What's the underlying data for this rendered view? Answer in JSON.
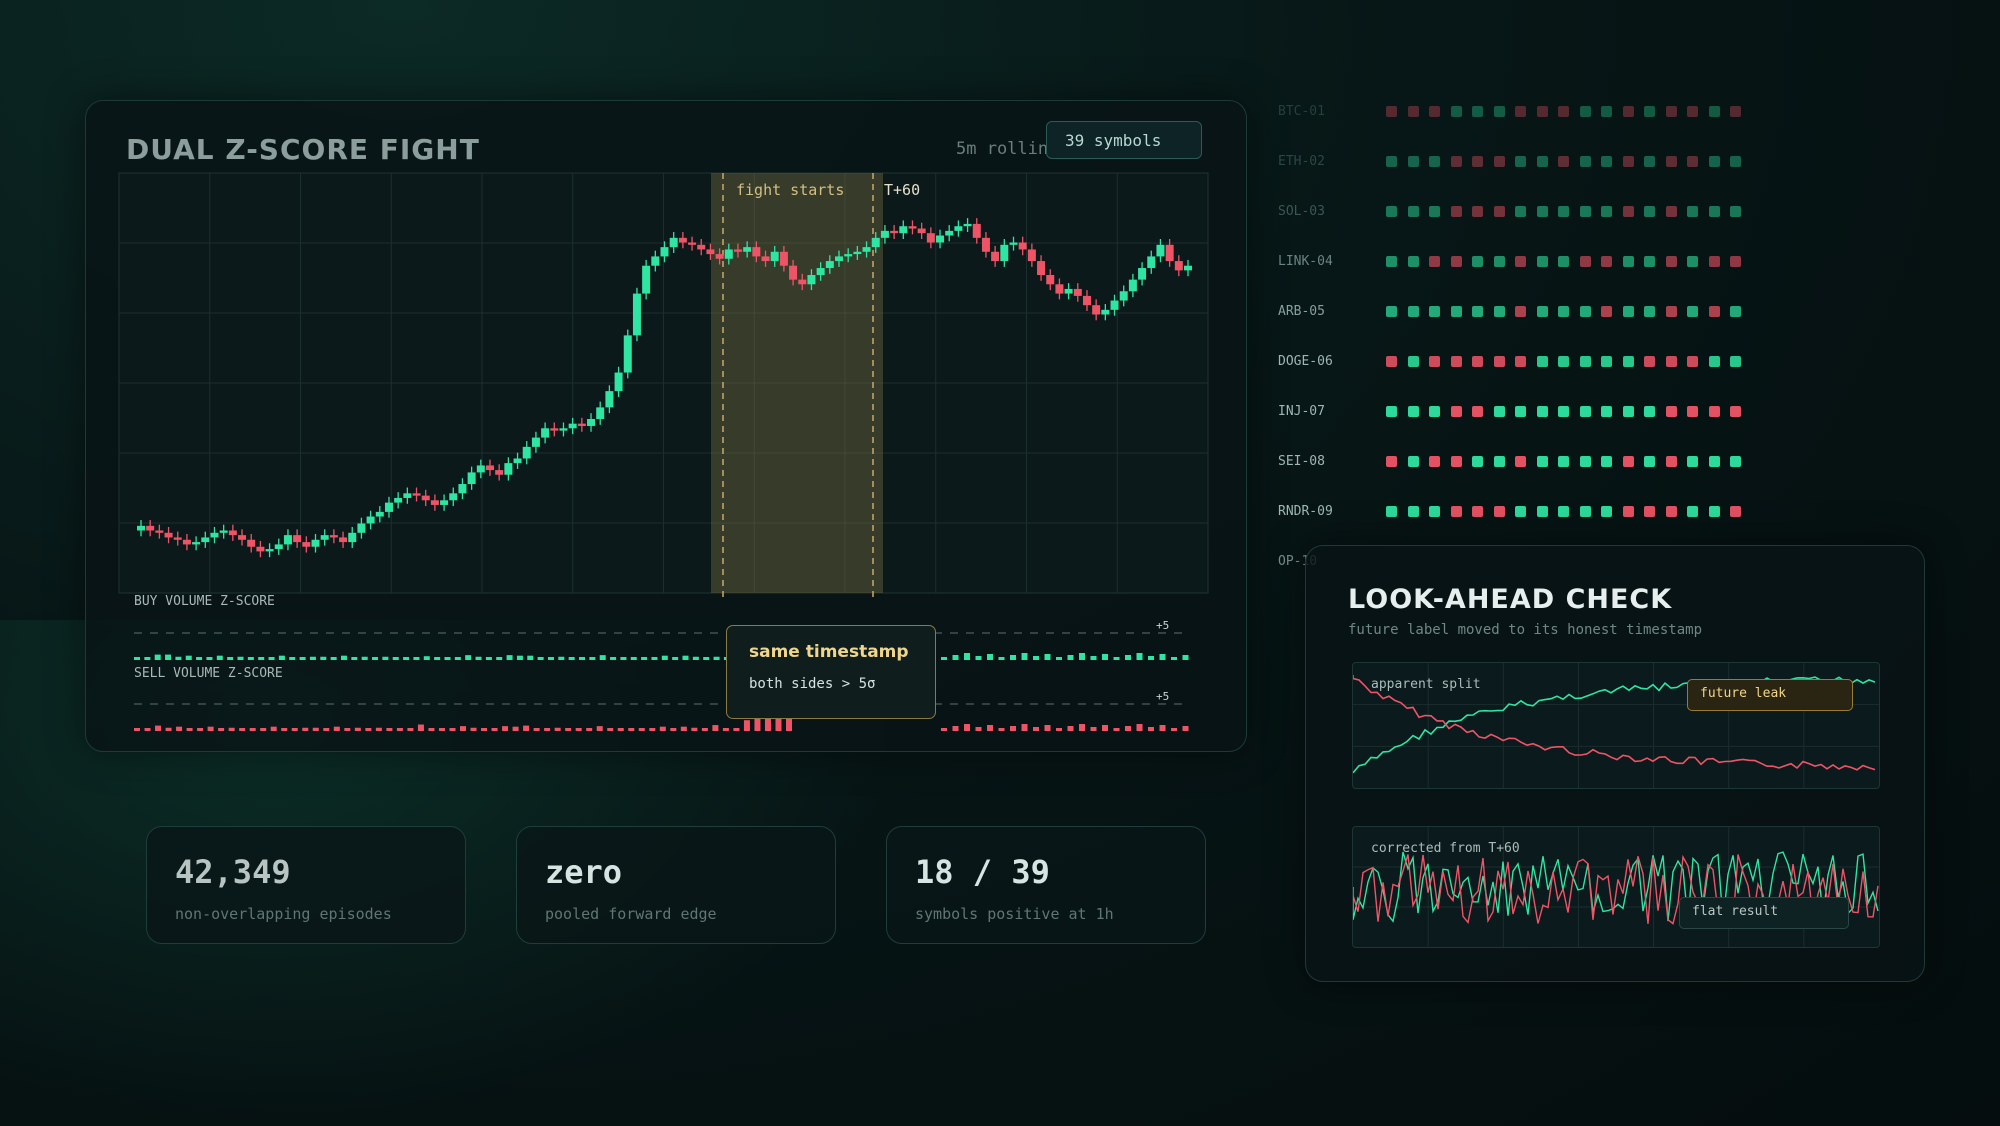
{
  "main": {
    "title": "DUAL Z-SCORE FIGHT",
    "rolling_label": "5m rollin",
    "symbols_badge": "39 symbols",
    "fight_label": "fight starts",
    "t60_label": "T+60",
    "buy_label": "BUY VOLUME Z-SCORE",
    "sell_label": "SELL VOLUME Z-SCORE",
    "buy_threshold": "+5",
    "sell_threshold": "+5",
    "callout": {
      "title": "same timestamp",
      "subtitle": "both sides > 5σ"
    },
    "colors": {
      "up": "#2ee6a2",
      "down": "#ef5466",
      "highlight": "#8a7a45"
    }
  },
  "chart_data": [
    {
      "type": "candlestick",
      "title": "DUAL Z-SCORE FIGHT",
      "highlight_window": {
        "start_index": 63,
        "end_index": 79,
        "labels": [
          "fight starts",
          "T+60"
        ]
      },
      "closes": [
        46,
        44,
        43,
        41,
        40,
        38,
        39,
        41,
        43,
        44,
        42,
        40,
        37,
        35,
        36,
        38,
        42,
        39,
        37,
        40,
        42,
        41,
        39,
        43,
        47,
        50,
        52,
        56,
        58,
        60,
        59,
        57,
        55,
        57,
        60,
        64,
        69,
        72,
        70,
        68,
        73,
        75,
        80,
        84,
        88,
        87,
        88,
        90,
        89,
        92,
        97,
        104,
        112,
        128,
        146,
        158,
        162,
        166,
        170,
        168,
        167,
        165,
        163,
        161,
        165,
        164,
        166,
        162,
        160,
        164,
        158,
        152,
        150,
        154,
        157,
        160,
        162,
        163,
        164,
        166,
        170,
        173,
        172,
        175,
        174,
        172,
        168,
        171,
        173,
        175,
        176,
        170,
        164,
        160,
        167,
        168,
        165,
        160,
        154,
        150,
        146,
        148,
        145,
        141,
        137,
        139,
        143,
        147,
        152,
        157,
        162,
        167,
        160,
        156,
        158
      ],
      "ylabel": ""
    },
    {
      "type": "bar",
      "name": "BUY VOLUME Z-SCORE",
      "values": [
        0.5,
        0.4,
        1.0,
        1.0,
        0.6,
        0.8,
        0.5,
        0.4,
        0.8,
        0.5,
        0.6,
        0.3,
        0.5,
        0.3,
        0.8,
        0.5,
        0.3,
        0.6,
        0.6,
        0.5,
        0.8,
        0.4,
        0.6,
        0.5,
        0.6,
        0.3,
        0.5,
        0.4,
        0.7,
        0.3,
        0.5,
        0.5,
        0.9,
        0.6,
        0.4,
        0.5,
        0.9,
        0.8,
        0.8,
        0.4,
        0.5,
        0.6,
        0.5,
        0.3,
        0.4,
        0.9,
        0.5,
        0.5,
        0.4,
        0.5,
        0.3,
        0.8,
        0.4,
        0.8,
        0.6,
        0.5,
        0.6,
        0.4,
        0.5,
        2.2,
        2.8,
        3.1,
        4.5,
        5.8
      ],
      "threshold": 5
    },
    {
      "type": "bar",
      "name": "SELL VOLUME Z-SCORE",
      "values": [
        0.5,
        0.4,
        1.0,
        0.6,
        0.8,
        0.5,
        0.4,
        0.8,
        0.5,
        0.6,
        0.3,
        0.5,
        0.3,
        0.8,
        0.5,
        0.3,
        0.6,
        0.6,
        0.5,
        0.8,
        0.4,
        0.6,
        0.5,
        0.6,
        0.3,
        0.5,
        0.4,
        1.2,
        0.3,
        0.5,
        0.5,
        0.9,
        0.6,
        0.4,
        0.5,
        0.9,
        0.8,
        1.0,
        0.4,
        0.5,
        0.6,
        0.5,
        0.3,
        0.4,
        0.9,
        0.5,
        0.5,
        0.4,
        0.5,
        0.3,
        0.8,
        0.4,
        0.8,
        0.6,
        0.5,
        1.1,
        0.4,
        0.5,
        2.0,
        2.6,
        3.0,
        4.2,
        5.6
      ],
      "threshold": 5
    }
  ],
  "heatmap": {
    "rows": [
      {
        "label": "BTC-01",
        "cells": "rrrgggrrrggrgrrgr"
      },
      {
        "label": "ETH-02",
        "cells": "gggrrrggrggrgrrgg"
      },
      {
        "label": "SOL-03",
        "cells": "gggrrrgggggrgrggg"
      },
      {
        "label": "LINK-04",
        "cells": "ggrrggrggrrggrgrr"
      },
      {
        "label": "ARB-05",
        "cells": "ggggggrgggrggrgrg"
      },
      {
        "label": "DOGE-06",
        "cells": "rgrrrrrgggggrrrgg"
      },
      {
        "label": "INJ-07",
        "cells": "gggrrggggggggrrrr"
      },
      {
        "label": "SEI-08",
        "cells": "rgrrggrggggrgrggg"
      },
      {
        "label": "RNDR-09",
        "cells": "gggrrrgggggrrrggr"
      },
      {
        "label": "OP-10",
        "cells": ""
      }
    ]
  },
  "stats": [
    {
      "value": "42,349",
      "label": "non-overlapping episodes"
    },
    {
      "value": "zero",
      "label": "pooled forward edge"
    },
    {
      "value": "18 / 39",
      "label": "symbols positive at 1h"
    }
  ],
  "lookahead": {
    "title": "LOOK-AHEAD CHECK",
    "subtitle": "future label moved to its honest timestamp",
    "chart1_label": "apparent split",
    "chart1_tag": "future leak",
    "chart2_label": "corrected from T+60",
    "chart2_tag": "flat result"
  }
}
